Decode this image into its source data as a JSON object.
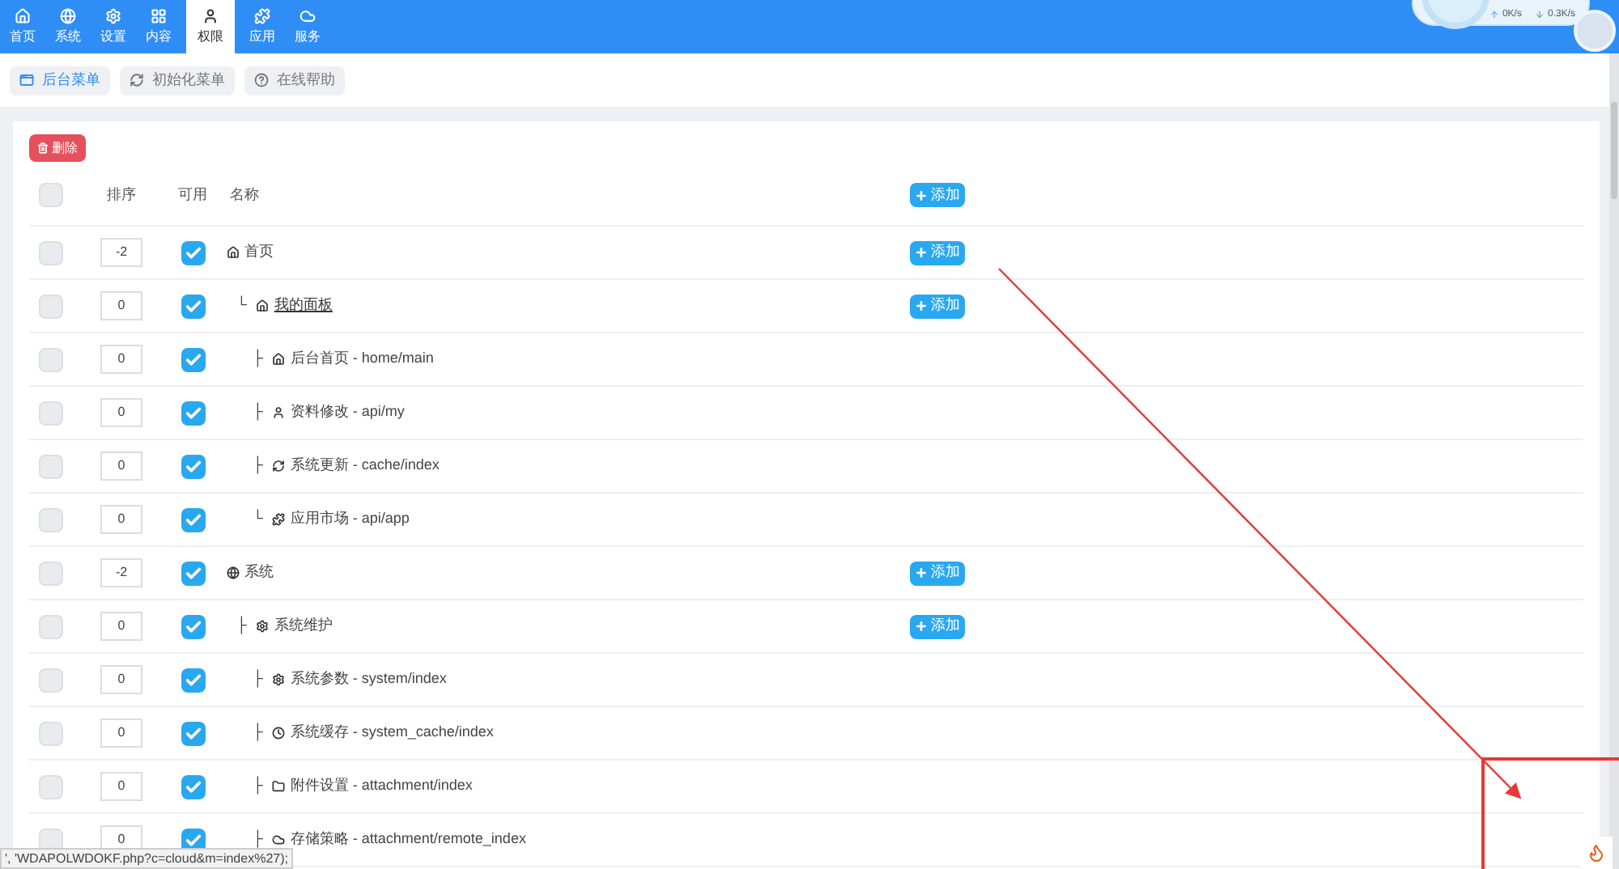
{
  "nav": [
    {
      "label": "首页",
      "kind": "home",
      "selected": false
    },
    {
      "label": "系统",
      "kind": "globe",
      "selected": false
    },
    {
      "label": "设置",
      "kind": "gears",
      "selected": false
    },
    {
      "label": "内容",
      "kind": "grid",
      "selected": false
    },
    {
      "label": "权限",
      "kind": "user",
      "selected": true
    },
    {
      "label": "应用",
      "kind": "puzzle",
      "selected": false
    },
    {
      "label": "服务",
      "kind": "cloud",
      "selected": false
    }
  ],
  "net_speed": {
    "up": "0K/s",
    "down": "0.3K/s"
  },
  "toolbar": [
    {
      "label": "后台菜单",
      "kind": "window",
      "selected": true
    },
    {
      "label": "初始化菜单",
      "kind": "refresh",
      "selected": false
    },
    {
      "label": "在线帮助",
      "kind": "help",
      "selected": false
    }
  ],
  "delete_button": "删除",
  "table": {
    "columns": [
      "排序",
      "可用",
      "名称"
    ],
    "select_all_checked": false,
    "header_add": "添加",
    "rows": [
      {
        "order": "-2",
        "enabled": true,
        "selected": false,
        "name": "首页",
        "kind": "home",
        "link": false,
        "add": "添加",
        "children": [
          {
            "prefix": "└",
            "order": "0",
            "enabled": true,
            "selected": false,
            "name": "我的面板",
            "kind": "home",
            "link": true,
            "add": "添加",
            "children": [
              {
                "prefix": "├",
                "order": "0",
                "enabled": true,
                "selected": false,
                "name": "后台首页 - home/main",
                "kind": "home",
                "link": false
              },
              {
                "prefix": "├",
                "order": "0",
                "enabled": true,
                "selected": false,
                "name": "资料修改 - api/my",
                "kind": "user",
                "link": false
              },
              {
                "prefix": "├",
                "order": "0",
                "enabled": true,
                "selected": false,
                "name": "系统更新 - cache/index",
                "kind": "refresh",
                "link": false
              },
              {
                "prefix": "└",
                "order": "0",
                "enabled": true,
                "selected": false,
                "name": "应用市场 - api/app",
                "kind": "puzzle",
                "link": false
              }
            ]
          }
        ]
      },
      {
        "order": "-2",
        "enabled": true,
        "selected": false,
        "name": "系统",
        "kind": "globe",
        "link": false,
        "add": "添加",
        "children": [
          {
            "prefix": "├",
            "order": "0",
            "enabled": true,
            "selected": false,
            "name": "系统维护",
            "kind": "gear",
            "link": false,
            "add": "添加",
            "children": [
              {
                "prefix": "├",
                "order": "0",
                "enabled": true,
                "selected": false,
                "name": "系统参数 - system/index",
                "kind": "gear",
                "link": false
              },
              {
                "prefix": "├",
                "order": "0",
                "enabled": true,
                "selected": false,
                "name": "系统缓存 - system_cache/index",
                "kind": "clock",
                "link": false
              },
              {
                "prefix": "├",
                "order": "0",
                "enabled": true,
                "selected": false,
                "name": "附件设置 - attachment/index",
                "kind": "folder",
                "link": false
              },
              {
                "prefix": "├",
                "order": "0",
                "enabled": true,
                "selected": false,
                "name": "存储策略 - attachment/remote_index",
                "kind": "cloud",
                "link": false
              }
            ]
          }
        ]
      }
    ]
  },
  "status_link": "', 'WDAPOLWDOKF.php?c=cloud&m=index%27);"
}
